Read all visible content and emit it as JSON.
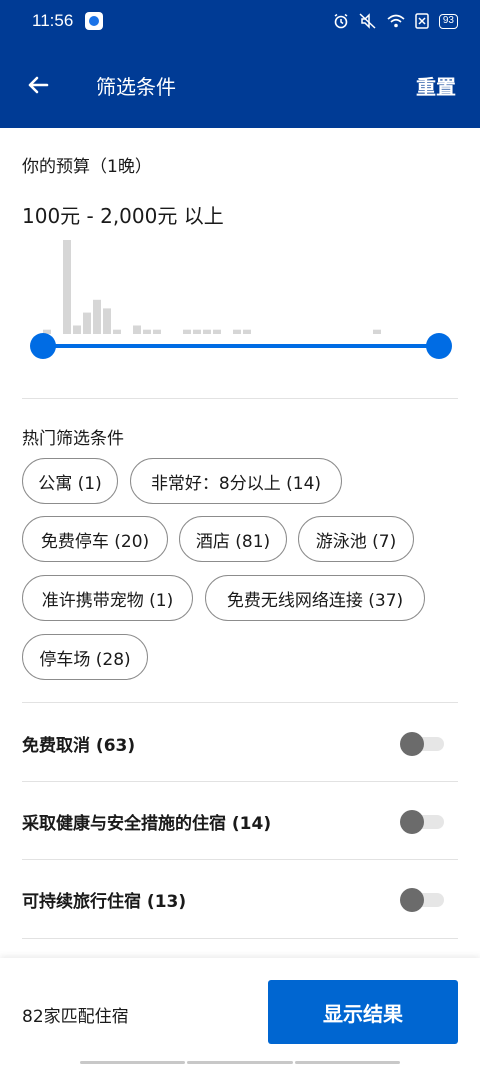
{
  "status_bar": {
    "time": "11:56",
    "battery": "93"
  },
  "app_bar": {
    "title": "筛选条件",
    "reset_label": "重置"
  },
  "budget": {
    "title": "你的预算（1晚）",
    "range_text": "100元 - 2,000元 以上",
    "histogram": [
      1,
      0,
      22,
      2,
      5,
      8,
      6,
      1,
      0,
      2,
      1,
      1,
      0,
      0,
      1,
      1,
      1,
      1,
      0,
      1,
      1,
      0,
      0,
      0,
      0,
      0,
      0,
      0,
      0,
      0,
      0,
      0,
      0,
      1,
      0,
      0,
      0,
      0,
      0,
      0
    ],
    "min_fraction": 0,
    "max_fraction": 1
  },
  "popular": {
    "title": "热门筛选条件",
    "chips": [
      {
        "label": "公寓 (1)"
      },
      {
        "label": "非常好：8分以上 (14)"
      },
      {
        "label": "免费停车 (20)"
      },
      {
        "label": "酒店 (81)"
      },
      {
        "label": "游泳池 (7)"
      },
      {
        "label": "准许携带宠物 (1)"
      },
      {
        "label": "免费无线网络连接 (37)"
      },
      {
        "label": "停车场 (28)"
      }
    ]
  },
  "toggles": [
    {
      "label": "免费取消 (63)",
      "on": false
    },
    {
      "label": "采取健康与安全措施的住宿 (14)",
      "on": false
    },
    {
      "label": "可持续旅行住宿 (13)",
      "on": false
    }
  ],
  "footer": {
    "match_count": "82家匹配住宿",
    "show_results_label": "显示结果"
  },
  "colors": {
    "brand_dark": "#003b95",
    "accent": "#006ce4",
    "button": "#0066d1"
  }
}
